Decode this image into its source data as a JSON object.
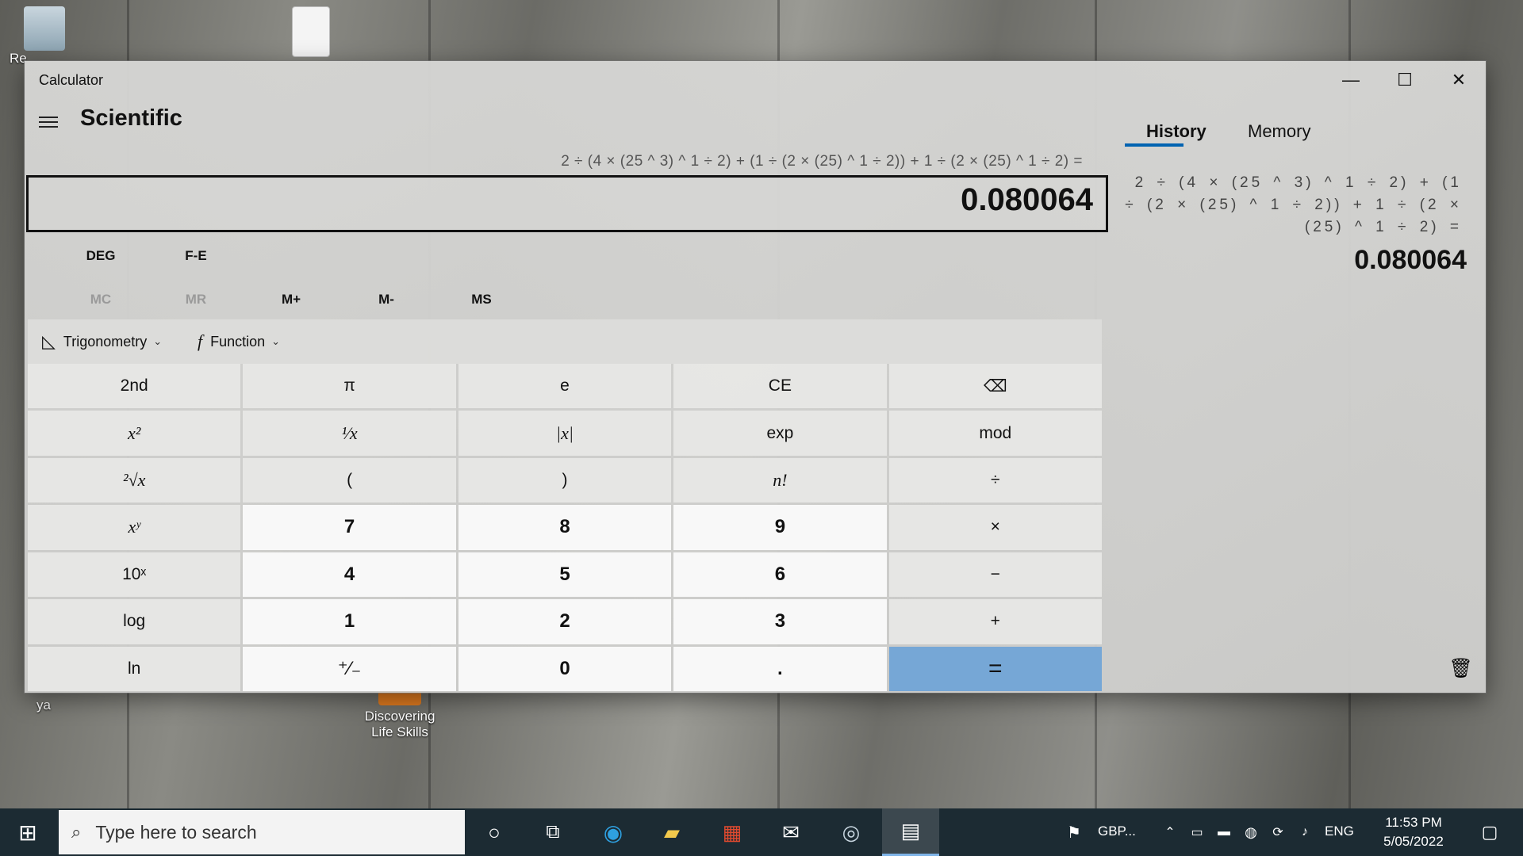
{
  "desktop": {
    "icons": [
      {
        "label": "Re"
      },
      {
        "label": "ya"
      },
      {
        "label": "Discovering Life Skills"
      }
    ]
  },
  "window": {
    "title": "Calculator",
    "controls": {
      "minimize": "—",
      "maximize": "☐",
      "close": "✕"
    }
  },
  "header": {
    "mode": "Scientific",
    "menu_icon": "hamburger-icon"
  },
  "display": {
    "expression": "2 ÷ (4 × (25 ^ 3) ^ 1 ÷ 2) + (1 ÷ (2 × (25) ^ 1 ÷ 2)) + 1 ÷ (2 × (25) ^ 1 ÷ 2) =",
    "value": "0.080064"
  },
  "modes": {
    "angle": "DEG",
    "fe": "F-E"
  },
  "memory": {
    "mc": "MC",
    "mr": "MR",
    "mplus": "M+",
    "mminus": "M-",
    "ms": "MS"
  },
  "functions": {
    "trig": "Trigonometry",
    "func": "Function"
  },
  "keys": [
    [
      "2nd",
      "π",
      "e",
      "CE",
      "⌫"
    ],
    [
      "x²",
      "¹⁄x",
      "|x|",
      "exp",
      "mod"
    ],
    [
      "²√x",
      "(",
      ")",
      "n!",
      "÷"
    ],
    [
      "xʸ",
      "7",
      "8",
      "9",
      "×"
    ],
    [
      "10ˣ",
      "4",
      "5",
      "6",
      "−"
    ],
    [
      "log",
      "1",
      "2",
      "3",
      "+"
    ],
    [
      "ln",
      "⁺∕₋",
      "0",
      ".",
      "="
    ]
  ],
  "history": {
    "tabs": {
      "history": "History",
      "memory": "Memory"
    },
    "entries": [
      {
        "expression": "2 ÷ (4 × (25 ^ 3) ^ 1 ÷ 2) + (1 ÷ (2 × (25) ^ 1 ÷ 2)) + 1 ÷ (2 × (25) ^ 1 ÷ 2) =",
        "result": "0.080064"
      }
    ],
    "clear_icon": "trash-icon"
  },
  "taskbar": {
    "search_placeholder": "Type here to search",
    "currency": "GBP...",
    "language": "ENG",
    "time": "11:53 PM",
    "date": "5/05/2022"
  },
  "colors": {
    "accent": "#0063b1",
    "equals_bg": "#76a7d6",
    "taskbar": "#1c2b33"
  }
}
